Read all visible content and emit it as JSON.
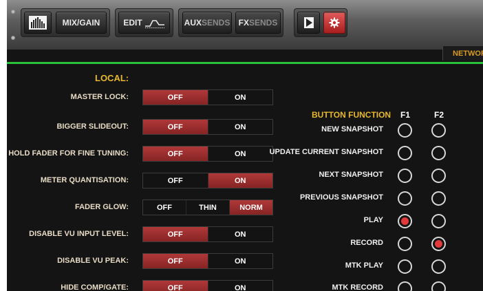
{
  "toolbar": {
    "mix_gain_label": "MIX/GAIN",
    "edit_label": "EDIT",
    "aux_label_strong": "AUX",
    "aux_label_dim": "SENDS",
    "fx_label_strong": "FX",
    "fx_label_dim": "SENDS",
    "accent_color": "#c72a2a"
  },
  "network_tab": "NETWORK",
  "local": {
    "title": "LOCAL:",
    "settings": [
      {
        "label": "MASTER LOCK:",
        "options": [
          "OFF",
          "ON"
        ],
        "selected": "OFF"
      },
      {
        "label": "BIGGER SLIDEOUT:",
        "options": [
          "OFF",
          "ON"
        ],
        "selected": "OFF"
      },
      {
        "label": "HOLD FADER FOR FINE TUNING:",
        "options": [
          "OFF",
          "ON"
        ],
        "selected": "OFF"
      },
      {
        "label": "METER QUANTISATION:",
        "options": [
          "OFF",
          "ON"
        ],
        "selected": "ON"
      },
      {
        "label": "FADER GLOW:",
        "options": [
          "OFF",
          "THIN",
          "NORM"
        ],
        "selected": "NORM"
      },
      {
        "label": "DISABLE VU INPUT LEVEL:",
        "options": [
          "OFF",
          "ON"
        ],
        "selected": "OFF"
      },
      {
        "label": "DISABLE VU PEAK:",
        "options": [
          "OFF",
          "ON"
        ],
        "selected": "OFF"
      },
      {
        "label": "HIDE COMP/GATE:",
        "options": [
          "OFF",
          "ON"
        ],
        "selected": "OFF"
      }
    ]
  },
  "button_function": {
    "title": "BUTTON FUNCTION",
    "columns": [
      "F1",
      "F2"
    ],
    "rows": [
      {
        "label": "NEW SNAPSHOT",
        "f1": false,
        "f2": false
      },
      {
        "label": "UPDATE CURRENT SNAPSHOT",
        "f1": false,
        "f2": false
      },
      {
        "label": "NEXT SNAPSHOT",
        "f1": false,
        "f2": false
      },
      {
        "label": "PREVIOUS SNAPSHOT",
        "f1": false,
        "f2": false
      },
      {
        "label": "PLAY",
        "f1": true,
        "f2": false
      },
      {
        "label": "RECORD",
        "f1": false,
        "f2": true
      },
      {
        "label": "MTK PLAY",
        "f1": false,
        "f2": false
      },
      {
        "label": "MTK RECORD",
        "f1": false,
        "f2": false
      }
    ]
  }
}
